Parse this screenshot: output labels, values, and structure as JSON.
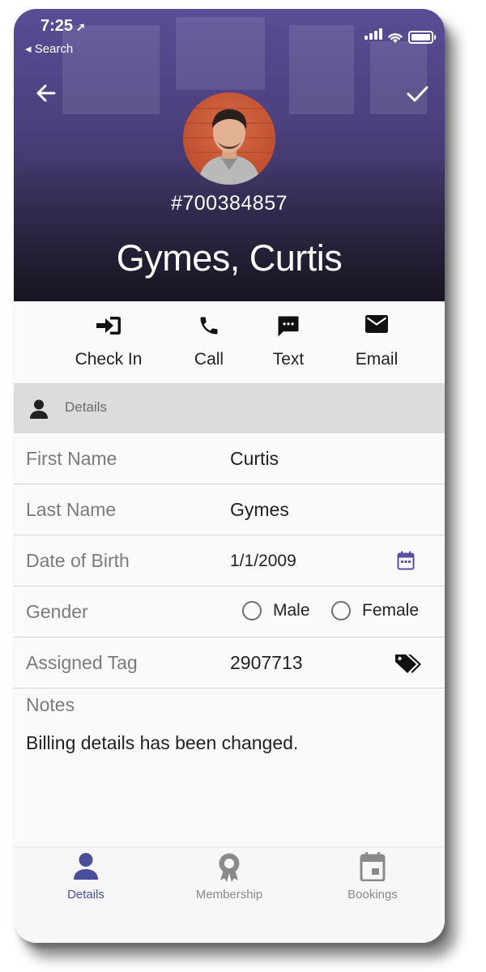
{
  "status_bar": {
    "time": "7:25",
    "back_label": "◂ Search"
  },
  "header": {
    "member_id": "#700384857",
    "name": "Gymes, Curtis"
  },
  "actions": [
    {
      "label": "Check In",
      "icon": "check-in-icon"
    },
    {
      "label": "Call",
      "icon": "phone-icon"
    },
    {
      "label": "Text",
      "icon": "message-icon"
    },
    {
      "label": "Email",
      "icon": "email-icon"
    }
  ],
  "section": {
    "title": "Details",
    "icon": "person-icon"
  },
  "fields": {
    "first_name": {
      "label": "First Name",
      "value": "Curtis"
    },
    "last_name": {
      "label": "Last Name",
      "value": "Gymes"
    },
    "dob": {
      "label": "Date of Birth",
      "value": "1/1/2009"
    },
    "gender": {
      "label": "Gender",
      "options": [
        "Male",
        "Female"
      ]
    },
    "tag": {
      "label": "Assigned Tag",
      "value": "2907713"
    }
  },
  "notes": {
    "label": "Notes",
    "text": "Billing details has been changed."
  },
  "tabs": [
    {
      "label": "Details",
      "active": true
    },
    {
      "label": "Membership",
      "active": false
    },
    {
      "label": "Bookings",
      "active": false
    }
  ],
  "colors": {
    "accent": "#4a4f9c",
    "header_purple": "#4b3f7d",
    "section_bg": "#dcdcdc",
    "inactive_tab": "#8a8a8a"
  }
}
